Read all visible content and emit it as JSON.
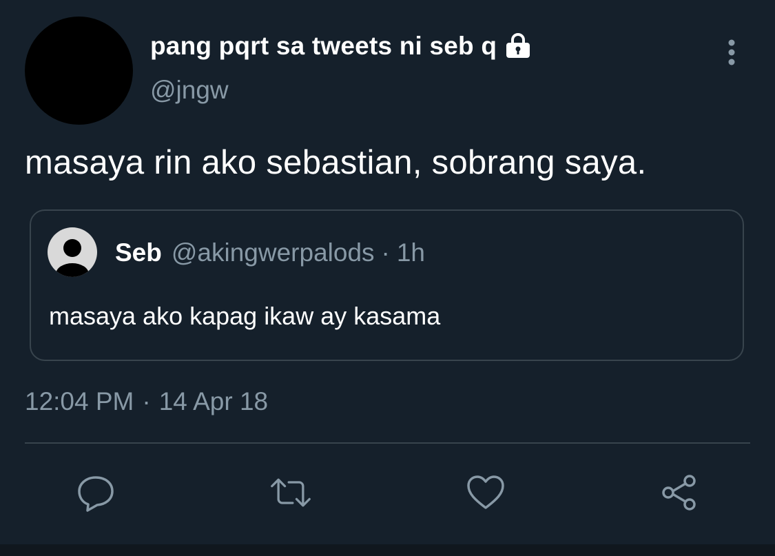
{
  "author": {
    "display_name": "pang pqrt sa tweets ni seb q",
    "handle": "@jngw",
    "protected_icon": "lock-icon"
  },
  "tweet": {
    "text": "masaya rin ako sebastian, sobrang saya.",
    "time": "12:04 PM",
    "separator": "·",
    "date": "14 Apr 18"
  },
  "quoted_tweet": {
    "name": "Seb",
    "handle": "@akingwerpalods",
    "separator": "·",
    "time": "1h",
    "text": "masaya ako kapag ikaw ay kasama"
  },
  "actions": [
    {
      "icon": "reply-icon"
    },
    {
      "icon": "retweet-icon"
    },
    {
      "icon": "like-icon"
    },
    {
      "icon": "share-icon"
    }
  ],
  "colors": {
    "background": "#15202b",
    "primary_text": "#ffffff",
    "secondary_text": "#8899a6",
    "border": "#38444d"
  }
}
